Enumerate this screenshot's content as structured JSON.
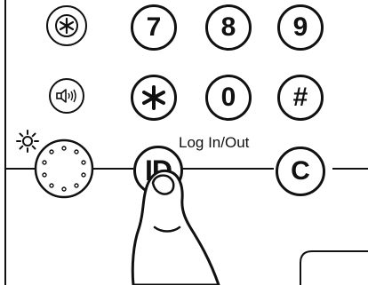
{
  "keypad": {
    "digit_7": "7",
    "digit_8": "8",
    "digit_9": "9",
    "digit_0": "0",
    "hash": "#",
    "id_key": "ID",
    "clear_key": "C"
  },
  "captions": {
    "log_in_out": "Log In/Out"
  },
  "icons": {
    "star_key": "asterisk-icon",
    "function_key": "circled-asterisk-icon",
    "volume_key": "speaker-volume-icon",
    "brightness": "sun-brightness-icon",
    "brightness_dial": "brightness-dial",
    "hand": "pointing-finger-icon"
  }
}
